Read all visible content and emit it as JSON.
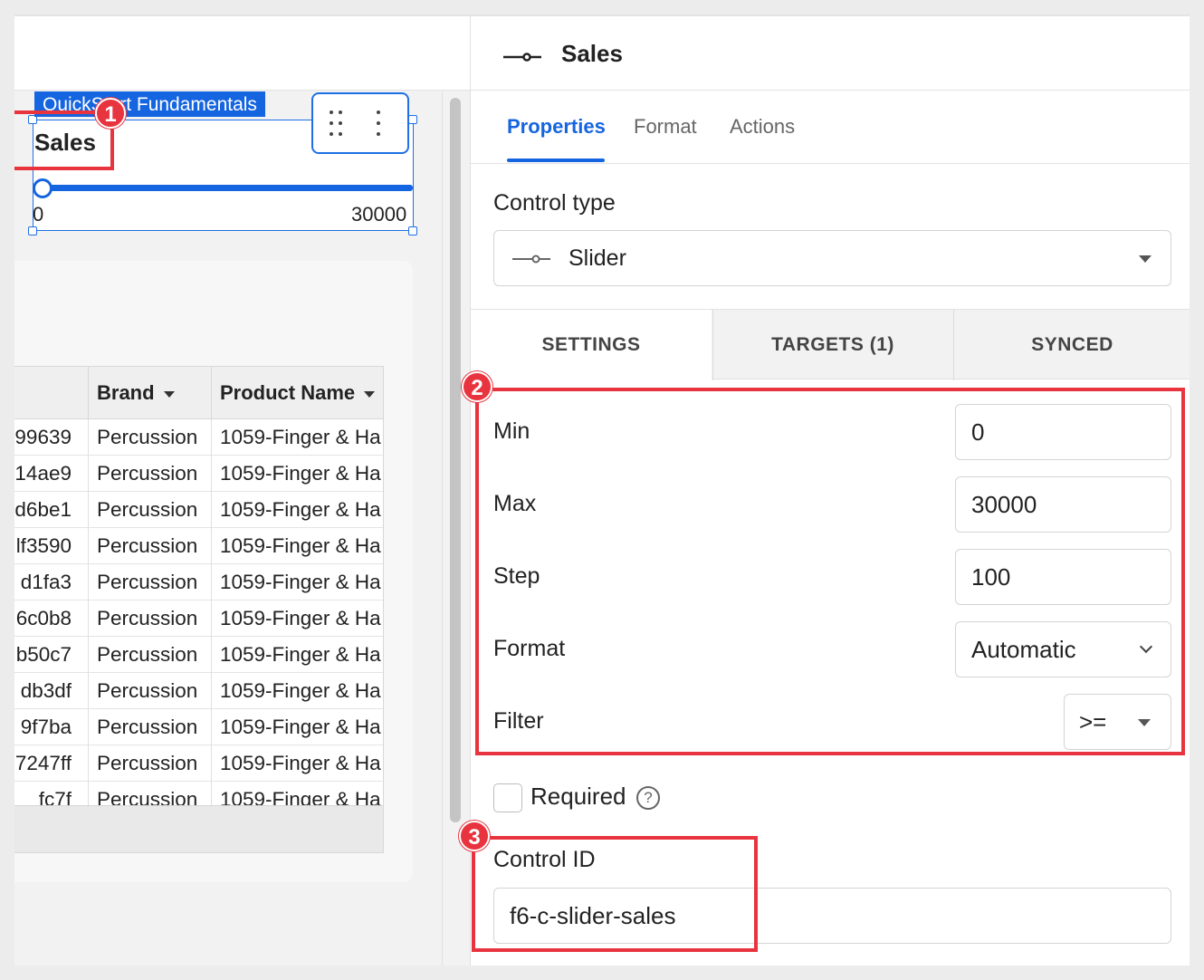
{
  "workbook": {
    "page_tag": "QuickStart Fundamentals",
    "slider_control": {
      "label": "Sales",
      "min_label": "0",
      "max_label": "30000",
      "value_fraction": 0
    },
    "table": {
      "columns": [
        "",
        "Brand",
        "Product Name"
      ],
      "rows": [
        [
          "99639",
          "Percussion",
          "1059-Finger & Ha"
        ],
        [
          "14ae9",
          "Percussion",
          "1059-Finger & Ha"
        ],
        [
          "d6be1",
          "Percussion",
          "1059-Finger & Ha"
        ],
        [
          "lf3590",
          "Percussion",
          "1059-Finger & Ha"
        ],
        [
          "d1fa3",
          "Percussion",
          "1059-Finger & Ha"
        ],
        [
          "6c0b8",
          "Percussion",
          "1059-Finger & Ha"
        ],
        [
          "b50c7",
          "Percussion",
          "1059-Finger & Ha"
        ],
        [
          "db3df",
          "Percussion",
          "1059-Finger & Ha"
        ],
        [
          "9f7ba",
          "Percussion",
          "1059-Finger & Ha"
        ],
        [
          "7247ff",
          "Percussion",
          "1059-Finger & Ha"
        ],
        [
          "fc7f",
          "Percussion",
          "1059-Finger & Ha"
        ]
      ]
    }
  },
  "panel": {
    "title": "Sales",
    "tabs": [
      "Properties",
      "Format",
      "Actions"
    ],
    "active_tab": "Properties",
    "control_type": {
      "label": "Control type",
      "value": "Slider"
    },
    "subtabs": [
      "SETTINGS",
      "TARGETS (1)",
      "SYNCED"
    ],
    "settings": {
      "min": {
        "label": "Min",
        "value": "0"
      },
      "max": {
        "label": "Max",
        "value": "30000"
      },
      "step": {
        "label": "Step",
        "value": "100"
      },
      "format": {
        "label": "Format",
        "value": "Automatic"
      },
      "filter": {
        "label": "Filter",
        "value": ">="
      }
    },
    "required": {
      "label": "Required",
      "checked": false,
      "help_icon": "question-circle-icon",
      "help_glyph": "?"
    },
    "control_id": {
      "label": "Control ID",
      "value": "f6-c-slider-sales"
    }
  },
  "annotations": [
    "1",
    "2",
    "3"
  ],
  "colors": {
    "accent": "#1565e0",
    "callout": "#e8343f"
  }
}
